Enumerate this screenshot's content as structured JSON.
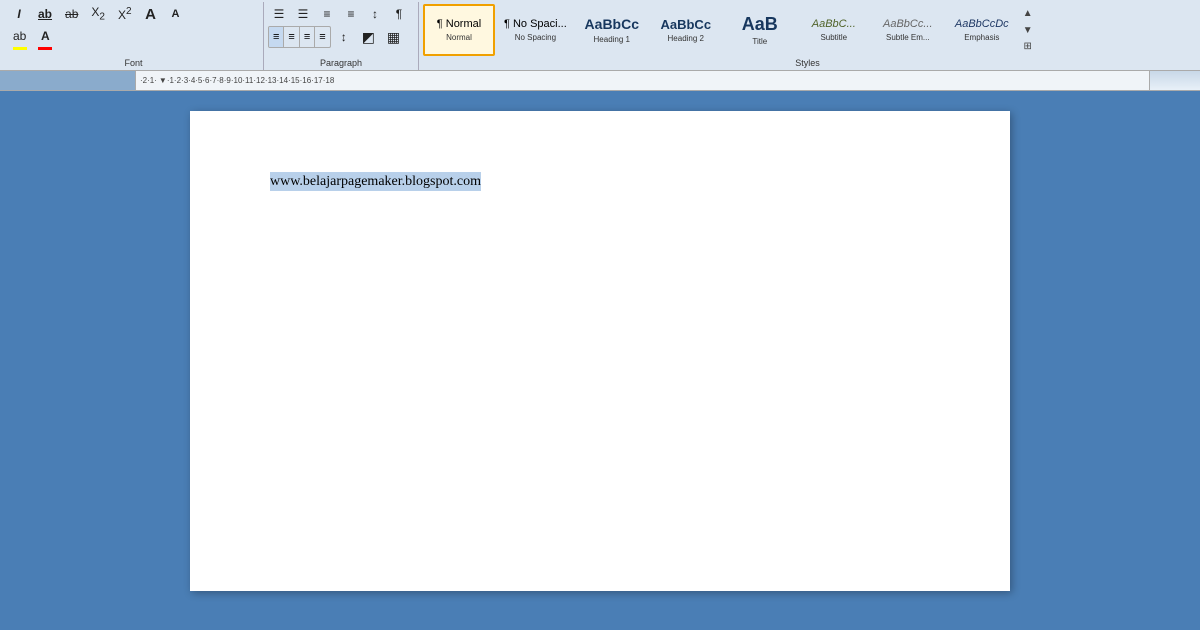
{
  "toolbar": {
    "font_section_label": "Font",
    "paragraph_section_label": "Paragraph",
    "styles_section_label": "Styles",
    "italic_label": "I",
    "underline_label": "ab",
    "strikethrough_label": "ab",
    "subscript_label": "X",
    "subscript_suffix": "₂",
    "superscript_label": "X",
    "superscript_suffix": "²",
    "font_size_label": "A",
    "grow_label": "A",
    "shrink_label": "A",
    "highlight_label": "ab",
    "font_color_label": "A",
    "indent_label": "≡",
    "outdent_label": "≡",
    "bullets_label": "☰",
    "numbering_label": "☰",
    "line_spacing_label": "↕",
    "shading_label": "◩",
    "borders_label": "▦"
  },
  "styles": {
    "items": [
      {
        "id": "normal",
        "preview": "¶ Normal",
        "label": "Normal",
        "class": "normal-text",
        "active": true
      },
      {
        "id": "no-spacing",
        "preview": "¶ No Spaci...",
        "label": "No Spacing",
        "class": "no-spacing",
        "active": false
      },
      {
        "id": "heading1",
        "preview": "AaBbCc",
        "label": "Heading 1",
        "class": "heading1",
        "active": false
      },
      {
        "id": "heading2",
        "preview": "AaBbCc",
        "label": "Heading 2",
        "class": "heading2",
        "active": false
      },
      {
        "id": "title",
        "preview": "AaB",
        "label": "Title",
        "class": "title-style",
        "active": false
      },
      {
        "id": "subtitle",
        "preview": "AaBbC...",
        "label": "Subtitle",
        "class": "subtitle-style",
        "active": false
      },
      {
        "id": "subtle-em",
        "preview": "AaBbCc...",
        "label": "Subtle Em...",
        "class": "subtle-em",
        "active": false
      },
      {
        "id": "emphasis",
        "preview": "AaBbCcDc",
        "label": "Emphasis",
        "class": "emphasis",
        "active": false
      }
    ]
  },
  "ruler": {
    "ticks": [
      "-2",
      "-1",
      "",
      "1",
      "2",
      "3",
      "4",
      "5",
      "6",
      "7",
      "8",
      "9",
      "10",
      "11",
      "12",
      "13",
      "14",
      "15",
      "16",
      "17",
      "18"
    ]
  },
  "document": {
    "selected_text": "www.belajarpagemaker.blogspot.com"
  }
}
